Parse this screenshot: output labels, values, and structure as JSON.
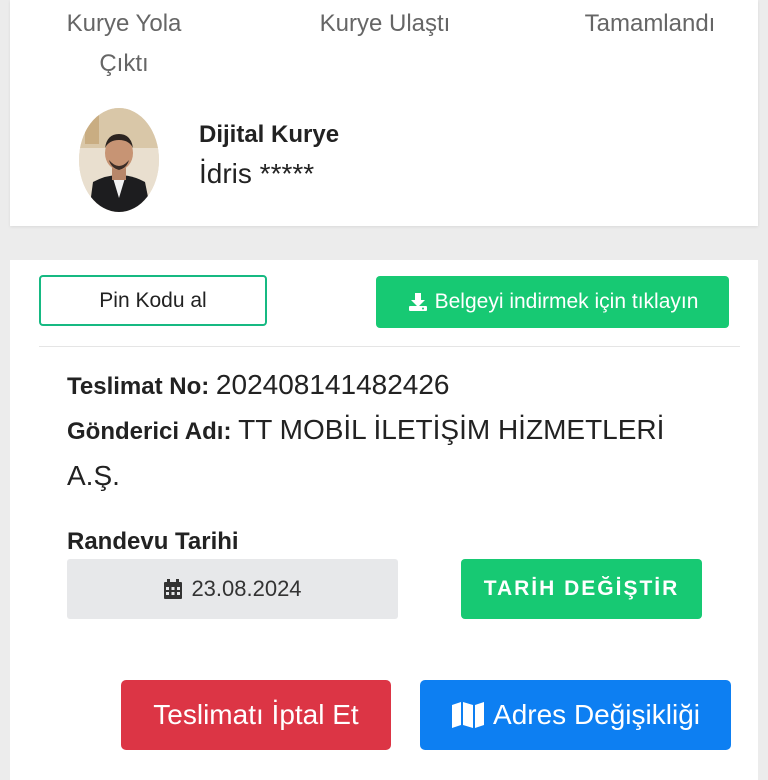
{
  "steps": [
    "Kurye Yola\nÇıktı",
    "Kurye Ulaştı",
    "Tamamlandı"
  ],
  "courier": {
    "title": "Dijital Kurye",
    "name": "İdris *****"
  },
  "actions": {
    "pin_label": "Pin Kodu al",
    "download_label": "Belgeyi indirmek için tıklayın",
    "download_icon": "download-icon"
  },
  "delivery": {
    "no_label": "Teslimat No",
    "no_value": "202408141482426",
    "sender_label": "Gönderici Adı",
    "sender_value": "TT MOBİL İLETİŞİM HİZMETLERİ A.Ş."
  },
  "appointment": {
    "label": "Randevu Tarihi",
    "date": "23.08.2024",
    "date_icon": "calendar-icon",
    "change_label": "TARİH DEĞİŞTİR"
  },
  "footer": {
    "cancel_label": "Teslimatı İptal Et",
    "address_label": "Adres Değişikliği",
    "address_icon": "map-icon"
  },
  "colors": {
    "green": "#17c973",
    "red": "#dc3545",
    "blue": "#0d7ff2",
    "outline_green": "#16b982"
  }
}
